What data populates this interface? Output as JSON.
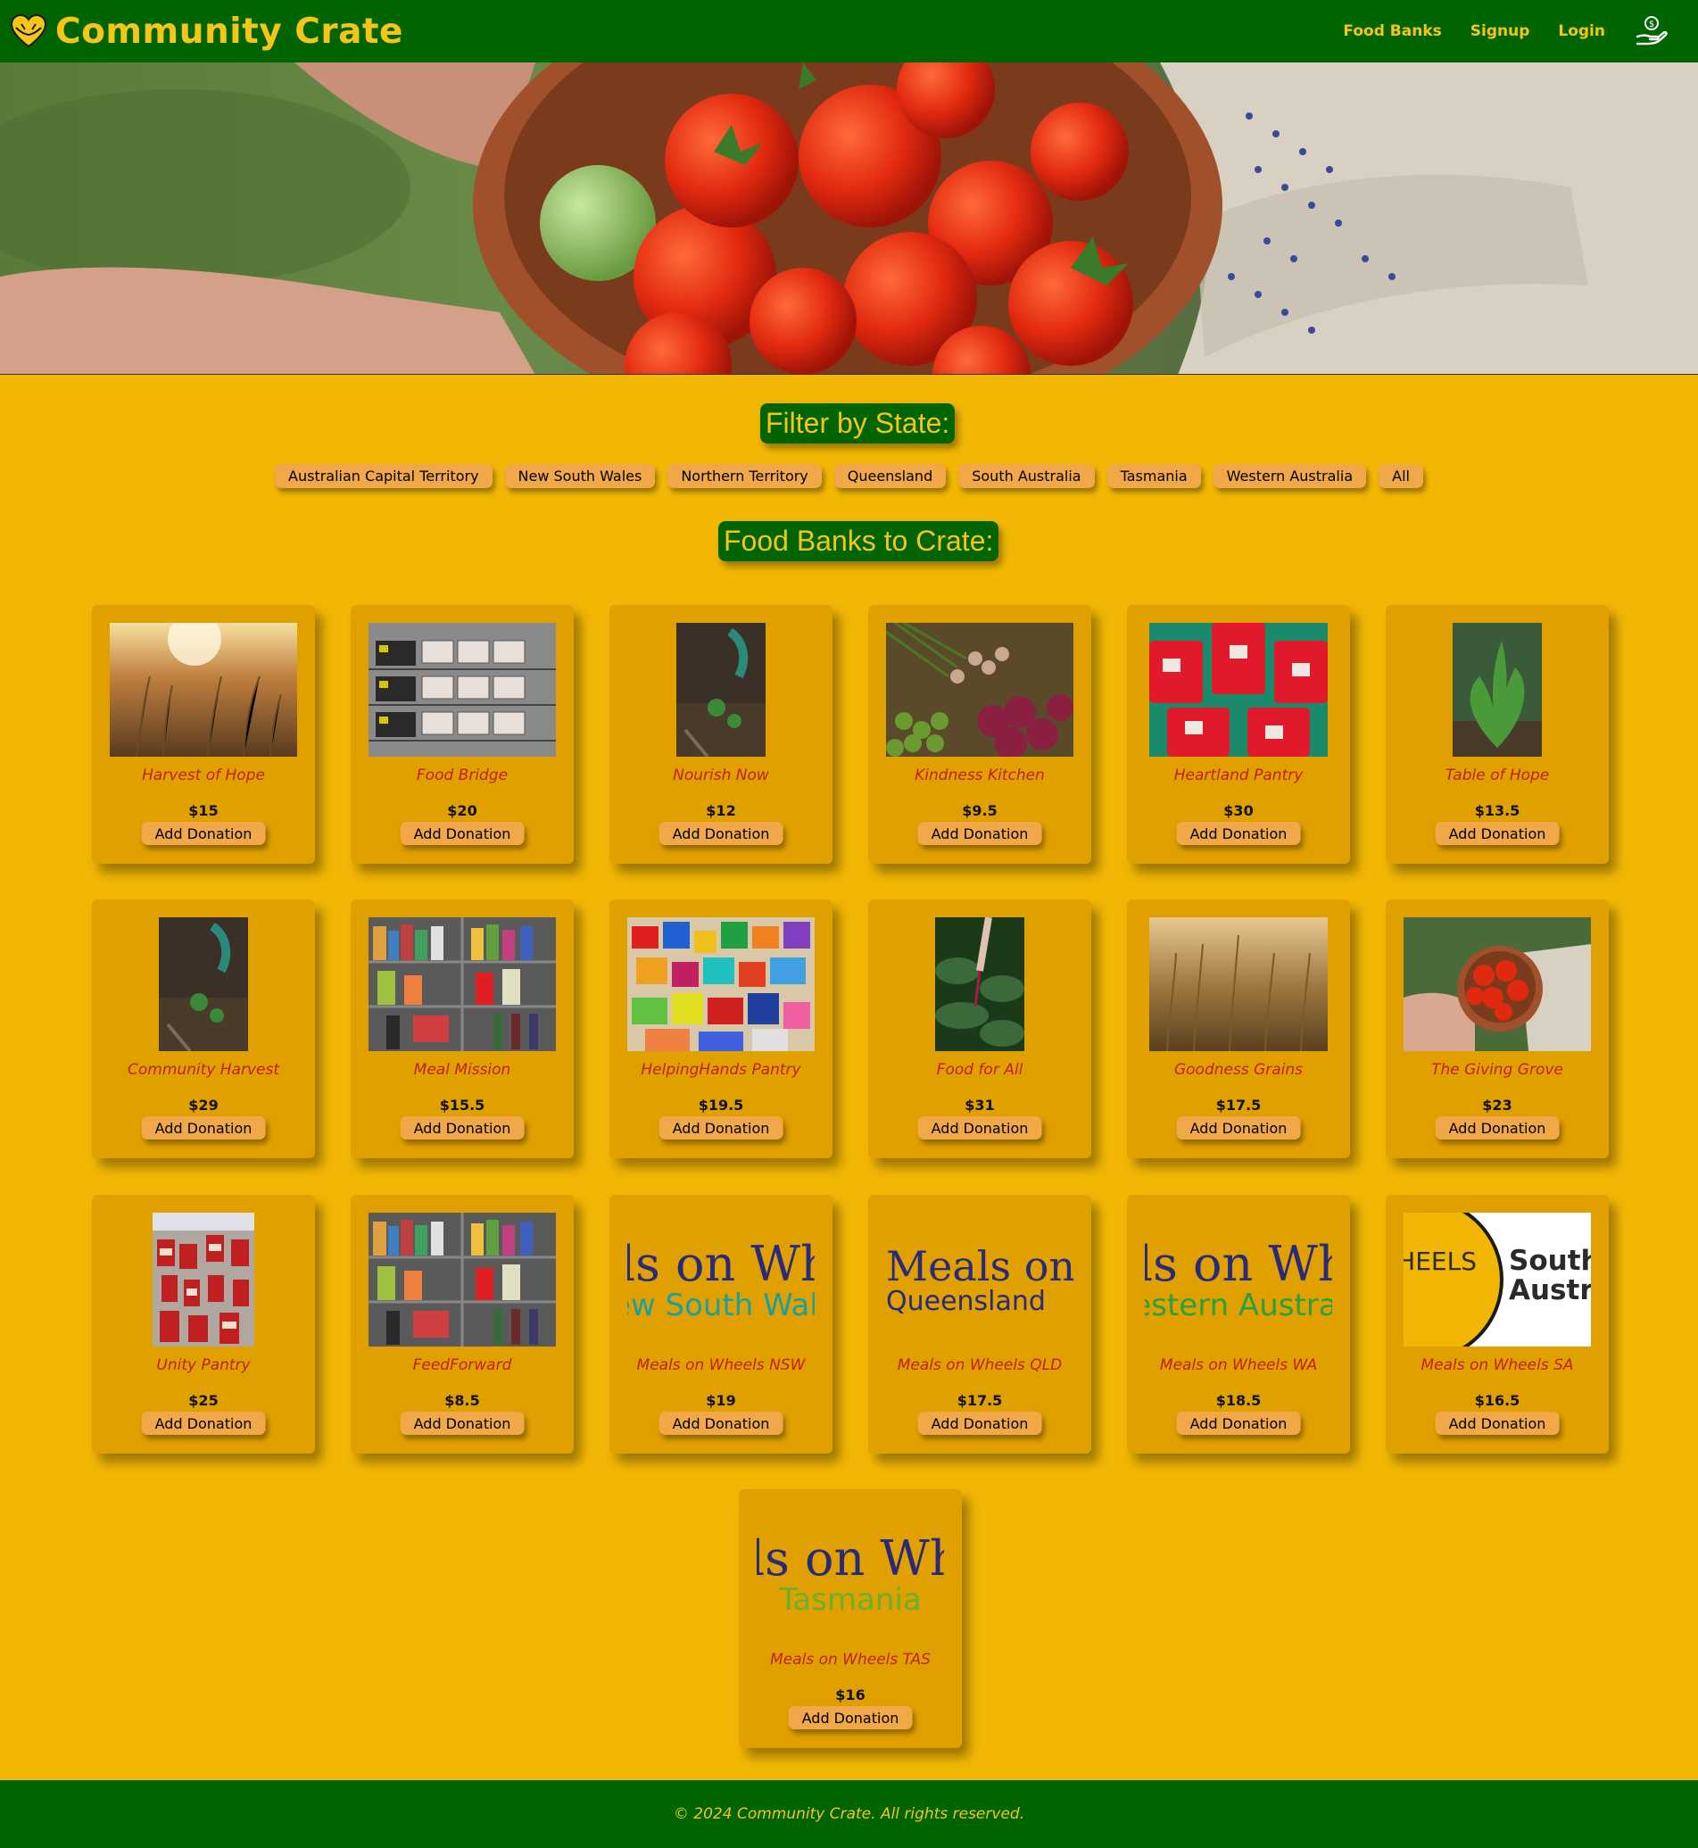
{
  "brand": {
    "name": "Community Crate",
    "logo_icon": "heart-hands-icon"
  },
  "nav": {
    "links": [
      "Food Banks",
      "Signup",
      "Login"
    ],
    "account_icon": "donate-hand-icon"
  },
  "filter": {
    "heading": "Filter by State:",
    "states": [
      "Australian Capital Territory",
      "New South Wales",
      "Northern Territory",
      "Queensland",
      "South Australia",
      "Tasmania",
      "Western Australia",
      "All"
    ]
  },
  "food_banks": {
    "heading": "Food Banks to Crate:",
    "button_label": "Add Donation",
    "items": [
      {
        "name": "Harvest of Hope",
        "price": "$15"
      },
      {
        "name": "Food Bridge",
        "price": "$20"
      },
      {
        "name": "Nourish Now",
        "price": "$12"
      },
      {
        "name": "Kindness Kitchen",
        "price": "$9.5"
      },
      {
        "name": "Heartland Pantry",
        "price": "$30"
      },
      {
        "name": "Table of Hope",
        "price": "$13.5"
      },
      {
        "name": "Community Harvest",
        "price": "$29"
      },
      {
        "name": "Meal Mission",
        "price": "$15.5"
      },
      {
        "name": "HelpingHands Pantry",
        "price": "$19.5"
      },
      {
        "name": "Food for All",
        "price": "$31"
      },
      {
        "name": "Goodness Grains",
        "price": "$17.5"
      },
      {
        "name": "The Giving Grove",
        "price": "$23"
      },
      {
        "name": "Unity Pantry",
        "price": "$25"
      },
      {
        "name": "FeedForward",
        "price": "$8.5"
      },
      {
        "name": "Meals on Wheels NSW",
        "price": "$19",
        "logo_text": [
          "Meals on Wheels",
          "New South Wales"
        ]
      },
      {
        "name": "Meals on Wheels QLD",
        "price": "$17.5",
        "logo_text": [
          "Meals on Wheels",
          "Queensland"
        ]
      },
      {
        "name": "Meals on Wheels WA",
        "price": "$18.5",
        "logo_text": [
          "Meals on Wheels",
          "Western Australia"
        ]
      },
      {
        "name": "Meals on Wheels SA",
        "price": "$16.5",
        "logo_text": [
          "MEALS ON WHEELS",
          "South Australia"
        ]
      },
      {
        "name": "Meals on Wheels TAS",
        "price": "$16",
        "logo_text": [
          "Meals on Wheels",
          "Tasmania"
        ]
      }
    ]
  },
  "footer": {
    "text": "© 2024 Community Crate. All rights reserved."
  },
  "colors": {
    "header_green": "#006400",
    "brand_yellow": "#f5c518",
    "page_bg": "#f2b705",
    "card_bg": "#e0a000",
    "button": "#f0a848",
    "name_red": "#c0201c"
  }
}
